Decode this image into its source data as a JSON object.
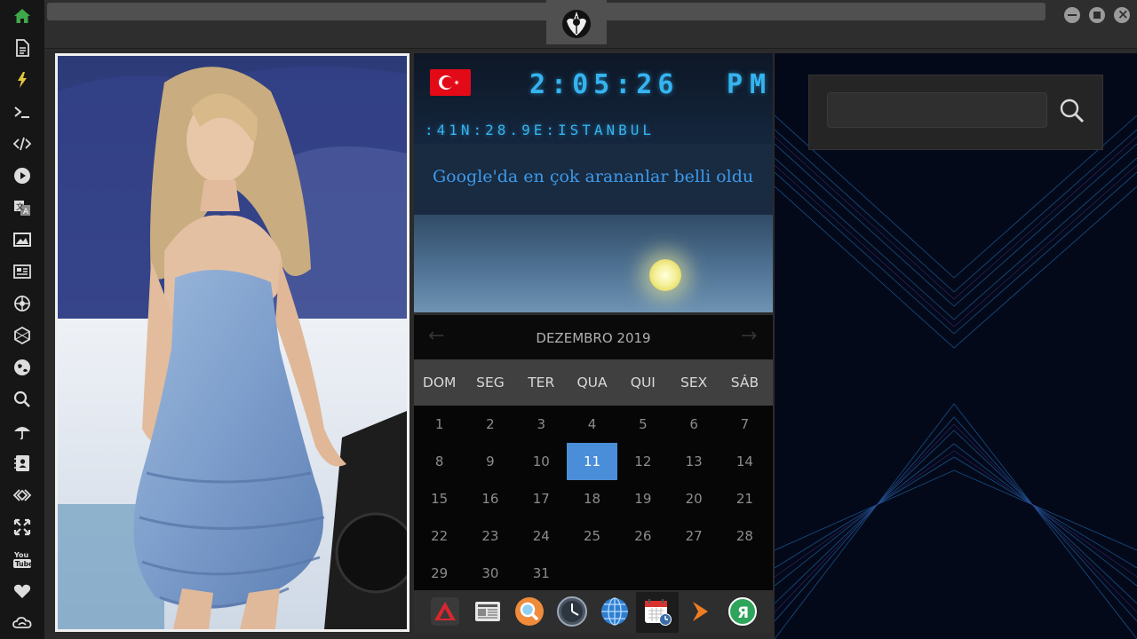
{
  "sidebar": {
    "items": [
      {
        "name": "home-icon",
        "color": "#3ea84a"
      },
      {
        "name": "document-icon"
      },
      {
        "name": "lightning-icon",
        "color": "#e3c53a"
      },
      {
        "name": "terminal-icon"
      },
      {
        "name": "code-icon"
      },
      {
        "name": "play-icon"
      },
      {
        "name": "translate-icon"
      },
      {
        "name": "image-icon"
      },
      {
        "name": "news-icon"
      },
      {
        "name": "rebel-icon"
      },
      {
        "name": "hexagon-icon"
      },
      {
        "name": "globe-icon"
      },
      {
        "name": "search-icon"
      },
      {
        "name": "umbrella-icon"
      },
      {
        "name": "contact-book-icon"
      },
      {
        "name": "share-code-icon"
      },
      {
        "name": "fullscreen-icon"
      },
      {
        "name": "youtube-icon",
        "label": "You Tube"
      },
      {
        "name": "heart-icon"
      },
      {
        "name": "cloud-icon"
      }
    ]
  },
  "window": {
    "controls": [
      "minimize",
      "maximize",
      "close"
    ]
  },
  "clock": {
    "flag": "turkey-flag",
    "time": "2:05:26",
    "ampm": "PM",
    "location": ":41N:28.9E:ISTANBUL",
    "headline": "Google'da en çok arananlar belli oldu"
  },
  "calendar": {
    "month_label": "DEZEMBRO 2019",
    "prev_arrow": "←",
    "next_arrow": "→",
    "weekdays": [
      "DOM",
      "SEG",
      "TER",
      "QUA",
      "QUI",
      "SEX",
      "SÁB"
    ],
    "weeks": [
      [
        "1",
        "2",
        "3",
        "4",
        "5",
        "6",
        "7"
      ],
      [
        "8",
        "9",
        "10",
        "11",
        "12",
        "13",
        "14"
      ],
      [
        "15",
        "16",
        "17",
        "18",
        "19",
        "20",
        "21"
      ],
      [
        "22",
        "23",
        "24",
        "25",
        "26",
        "27",
        "28"
      ],
      [
        "29",
        "30",
        "31",
        "",
        "",
        "",
        ""
      ]
    ],
    "today": "11",
    "highlight_color": "#4a8dd8"
  },
  "dock": {
    "apps": [
      {
        "name": "red-triangle-app-icon"
      },
      {
        "name": "newspaper-app-icon"
      },
      {
        "name": "magnifier-app-icon"
      },
      {
        "name": "clock-app-icon"
      },
      {
        "name": "globe-app-icon"
      },
      {
        "name": "calendar-app-icon",
        "active": true
      },
      {
        "name": "arrow-app-icon"
      },
      {
        "name": "yandex-app-icon",
        "label": "Я"
      }
    ]
  },
  "search": {
    "placeholder": "",
    "value": ""
  },
  "colors": {
    "accent": "#35b4f0",
    "headline": "#3d99ea",
    "panel": "#2e2e2e"
  }
}
